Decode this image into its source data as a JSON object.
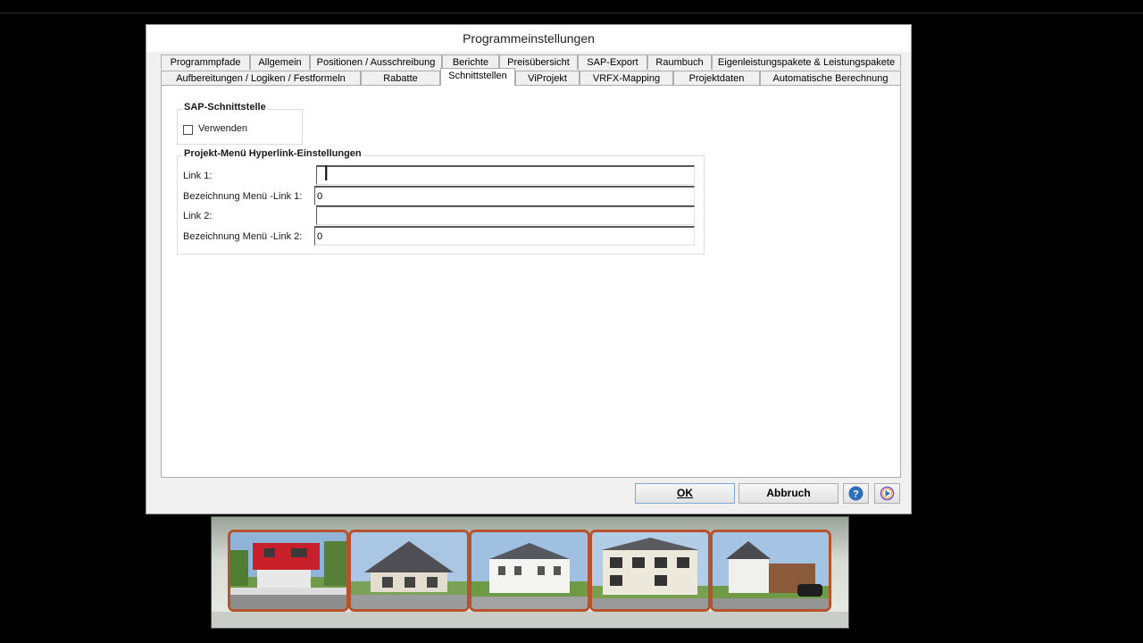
{
  "dialog": {
    "title": "Programmeinstellungen",
    "tabs_row1": [
      "Programmpfade",
      "Allgemein",
      "Positionen / Ausschreibung",
      "Berichte",
      "Preisübersicht",
      "SAP-Export",
      "Raumbuch",
      "Eigenleistungspakete & Leistungspakete"
    ],
    "tabs_row2": [
      "Aufbereitungen / Logiken / Festformeln",
      "Rabatte",
      "Schnittstellen",
      "ViProjekt",
      "VRFX-Mapping",
      "Projektdaten",
      "Automatische Berechnung"
    ],
    "active_tab": "Schnittstellen"
  },
  "sap_group": {
    "title": "SAP-Schnittstelle",
    "checkbox_label": "Verwenden",
    "checked": false
  },
  "hyperlink_group": {
    "title": "Projekt-Menü Hyperlink-Einstellungen",
    "fields": [
      {
        "label": "Link 1:",
        "value": ""
      },
      {
        "label": "Bezeichnung Menü -Link 1:",
        "value": "0"
      },
      {
        "label": "Link 2:",
        "value": ""
      },
      {
        "label": "Bezeichnung Menü -Link 2:",
        "value": "0"
      }
    ]
  },
  "buttons": {
    "ok": "OK",
    "cancel": "Abbruch",
    "help_icon": "help-icon",
    "media_icon": "play-icon"
  },
  "colors": {
    "help_blue": "#2d6fb8",
    "thumb_border": "#b5532f"
  }
}
